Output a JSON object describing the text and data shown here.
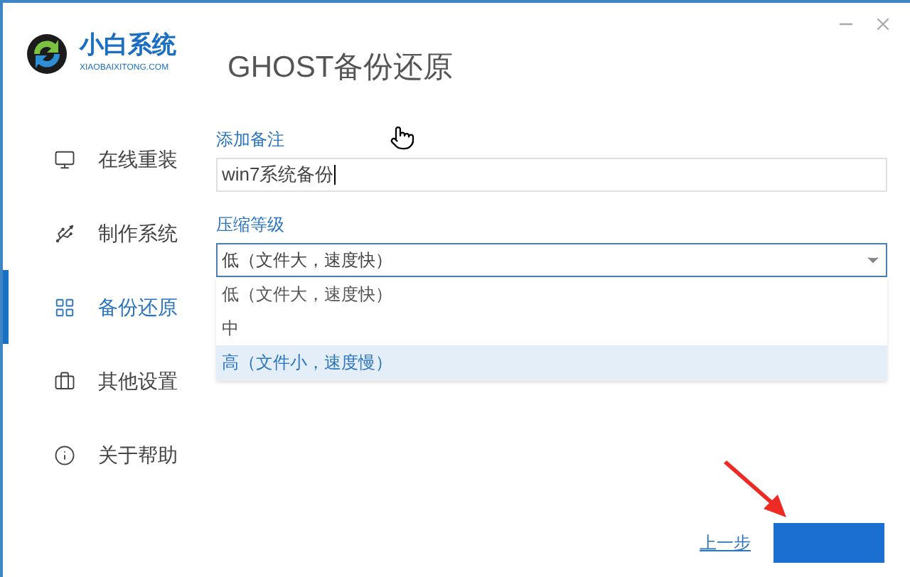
{
  "logo": {
    "name": "小白系统",
    "subtitle": "XIAOBAIXITONG.COM"
  },
  "page_title": "GHOST备份还原",
  "sidebar": {
    "items": [
      {
        "label": "在线重装",
        "selected": false
      },
      {
        "label": "制作系统",
        "selected": false
      },
      {
        "label": "备份还原",
        "selected": true
      },
      {
        "label": "其他设置",
        "selected": false
      },
      {
        "label": "关于帮助",
        "selected": false
      }
    ]
  },
  "note": {
    "label": "添加备注",
    "value": "win7系统备份"
  },
  "compression": {
    "label": "压缩等级",
    "value": "低（文件大，速度快）",
    "expanded": true,
    "options": [
      {
        "label": "低（文件大，速度快）",
        "highlighted": false
      },
      {
        "label": "中",
        "highlighted": false
      },
      {
        "label": "高（文件小，速度慢）",
        "highlighted": true
      }
    ]
  },
  "footer": {
    "back_link": "上一步"
  }
}
